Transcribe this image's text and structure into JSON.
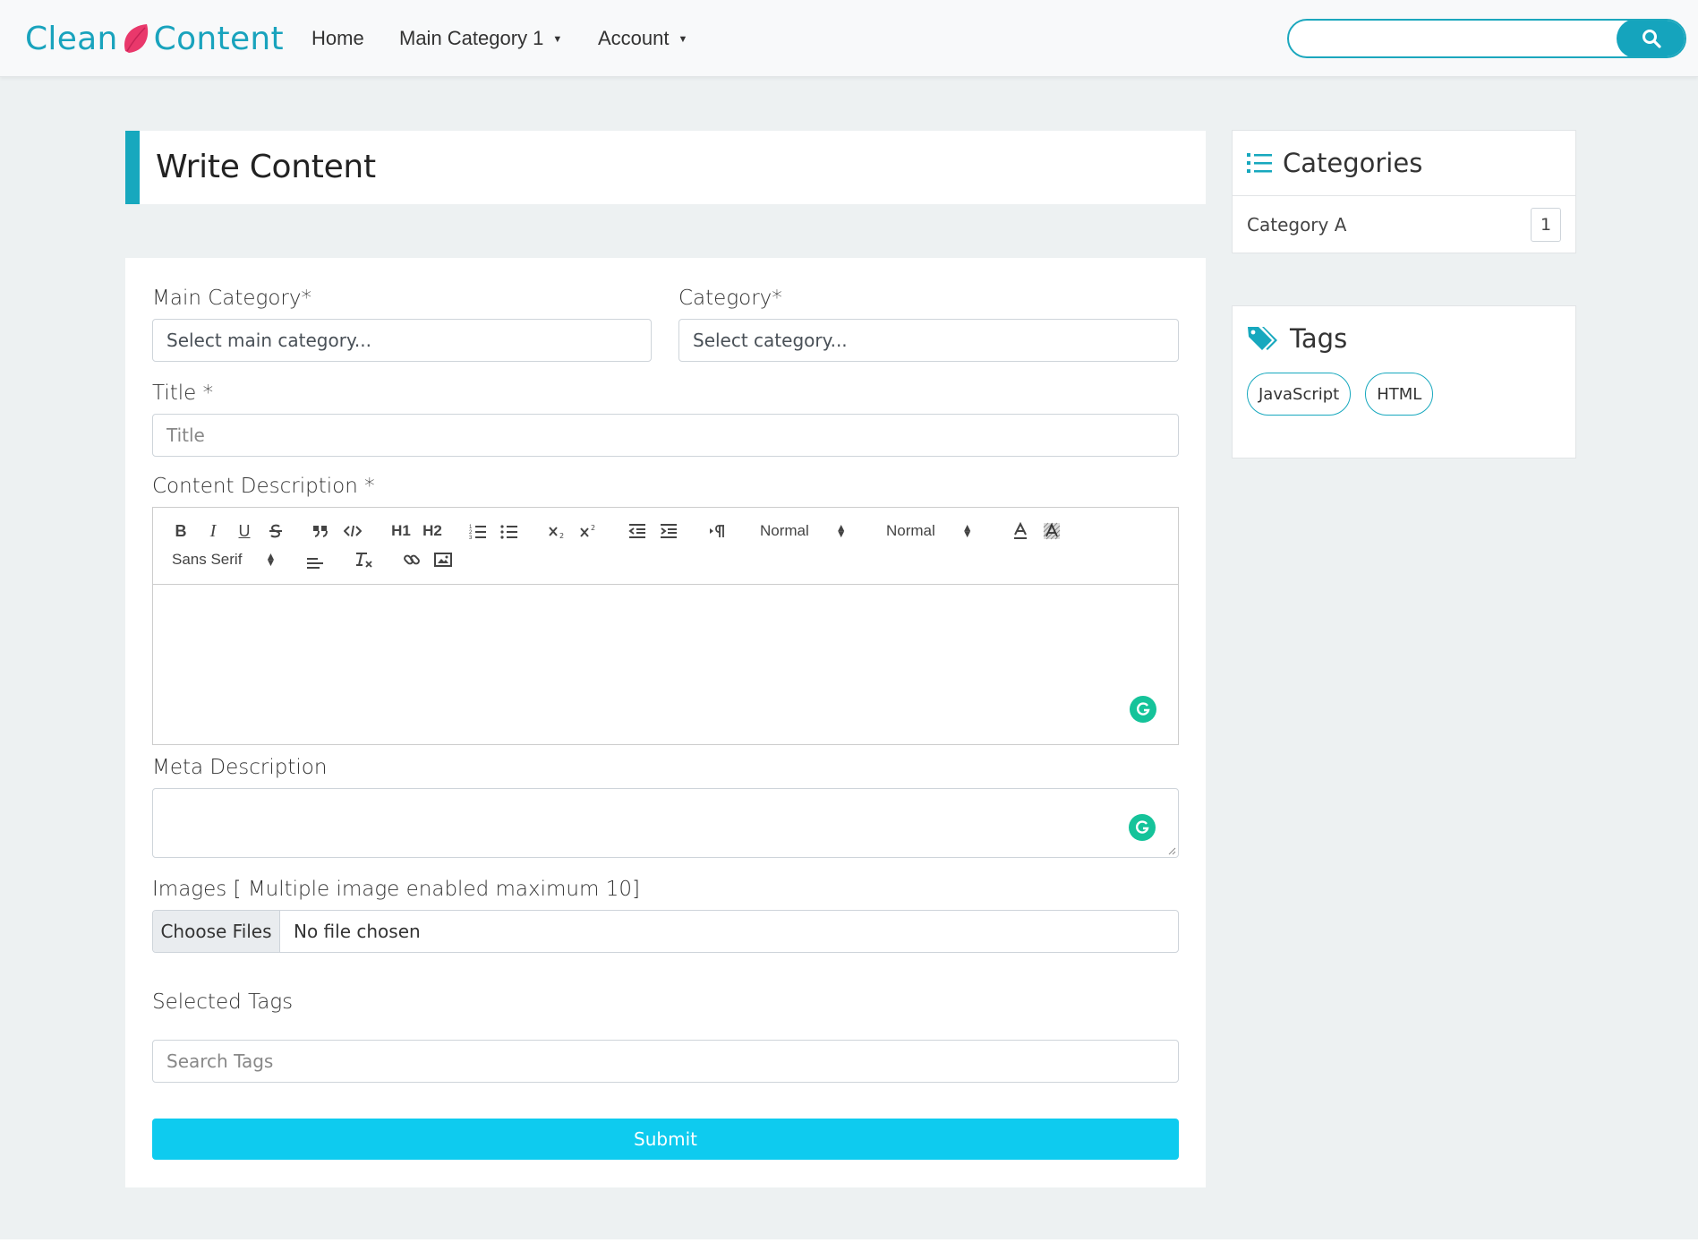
{
  "brand": {
    "part1": "Clean",
    "part2": "Content",
    "color": "#19a3bd",
    "leaf_color": "#e9386b"
  },
  "nav": {
    "home": "Home",
    "main_category": "Main Category 1",
    "account": "Account",
    "caret": "▼"
  },
  "search": {
    "placeholder": "",
    "icon": "search-icon"
  },
  "page": {
    "title": "Write Content"
  },
  "form": {
    "main_category_label": "Main Category*",
    "main_category_value": "Select main category...",
    "category_label": "Category*",
    "category_value": "Select category...",
    "title_label": "Title *",
    "title_placeholder": "Title",
    "content_label": "Content Description *",
    "toolbar": {
      "header_picker": "Normal",
      "size_picker": "Normal",
      "font_picker": "Sans Serif",
      "bold": "B",
      "italic": "I",
      "underline": "U",
      "h1": "H1",
      "h2": "H2"
    },
    "meta_label": "Meta Description",
    "images_label": "Images [ Multiple image enabled maximum 10]",
    "choose_files": "Choose Files",
    "no_file": "No file chosen",
    "selected_tags_label": "Selected Tags",
    "search_tags_placeholder": "Search Tags",
    "submit": "Submit"
  },
  "sidebar": {
    "categories_title": "Categories",
    "categories": [
      {
        "name": "Category A",
        "count": "1"
      }
    ],
    "tags_title": "Tags",
    "tags": [
      "JavaScript",
      "HTML"
    ]
  },
  "colors": {
    "accent": "#17a8be",
    "submit": "#0ecbef",
    "grammarly": "#15c39a"
  }
}
